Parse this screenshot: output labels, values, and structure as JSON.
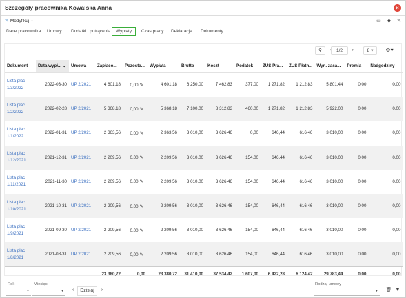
{
  "window": {
    "title": "Szczegóły pracownika Kowalska Anna"
  },
  "toolbar": {
    "modify_label": "Modyfikuj"
  },
  "tabs": [
    {
      "label": "Dane pracownika"
    },
    {
      "label": "Umowy"
    },
    {
      "label": "Dodatki i potrącenia"
    },
    {
      "label": "Wypłaty"
    },
    {
      "label": "Czas pracy"
    },
    {
      "label": "Deklaracje"
    },
    {
      "label": "Dokumenty"
    }
  ],
  "pager": {
    "page": "1/2",
    "page_size": "8"
  },
  "table": {
    "headers": [
      "Dokument",
      "Data wypł...",
      "Umowa",
      "Zapłaco...",
      "Pozosta...",
      "Wypłata",
      "Brutto",
      "Koszt",
      "Podatek",
      "ZUS Pra...",
      "ZUS Płatn...",
      "Wyn. zasa...",
      "Premia",
      "Nadgodziny"
    ],
    "rows": [
      {
        "doc": "Lista płac 1/3/2022",
        "date": "2022-03-30",
        "umowa": "UP 2/2021",
        "zaplacono": "4 601,18",
        "pozostalo": "0,00",
        "wyplata": "4 601,18",
        "brutto": "6 250,00",
        "koszt": "7 462,83",
        "podatek": "377,00",
        "zus_pra": "1 271,82",
        "zus_plat": "1 212,83",
        "wyn_zasad": "5 801,44",
        "premia": "0,00",
        "nadgodziny": "0,00"
      },
      {
        "doc": "Lista płac 1/2/2022",
        "date": "2022-02-28",
        "umowa": "UP 2/2021",
        "zaplacono": "5 368,18",
        "pozostalo": "0,00",
        "wyplata": "5 368,18",
        "brutto": "7 100,00",
        "koszt": "8 312,83",
        "podatek": "460,00",
        "zus_pra": "1 271,82",
        "zus_plat": "1 212,83",
        "wyn_zasad": "5 922,00",
        "premia": "0,00",
        "nadgodziny": "0,00"
      },
      {
        "doc": "Lista płac 1/1/2022",
        "date": "2022-01-31",
        "umowa": "UP 2/2021",
        "zaplacono": "2 363,56",
        "pozostalo": "0,00",
        "wyplata": "2 363,56",
        "brutto": "3 010,00",
        "koszt": "3 626,46",
        "podatek": "0,00",
        "zus_pra": "646,44",
        "zus_plat": "616,46",
        "wyn_zasad": "3 010,00",
        "premia": "0,00",
        "nadgodziny": "0,00"
      },
      {
        "doc": "Lista płac 1/12/2021",
        "date": "2021-12-31",
        "umowa": "UP 2/2021",
        "zaplacono": "2 209,56",
        "pozostalo": "0,00",
        "wyplata": "2 209,56",
        "brutto": "3 010,00",
        "koszt": "3 626,46",
        "podatek": "154,00",
        "zus_pra": "646,44",
        "zus_plat": "616,46",
        "wyn_zasad": "3 010,00",
        "premia": "0,00",
        "nadgodziny": "0,00"
      },
      {
        "doc": "Lista płac 1/11/2021",
        "date": "2021-11-30",
        "umowa": "UP 2/2021",
        "zaplacono": "2 209,56",
        "pozostalo": "0,00",
        "wyplata": "2 209,56",
        "brutto": "3 010,00",
        "koszt": "3 626,46",
        "podatek": "154,00",
        "zus_pra": "646,44",
        "zus_plat": "616,46",
        "wyn_zasad": "3 010,00",
        "premia": "0,00",
        "nadgodziny": "0,00"
      },
      {
        "doc": "Lista płac 1/10/2021",
        "date": "2021-10-31",
        "umowa": "UP 2/2021",
        "zaplacono": "2 209,56",
        "pozostalo": "0,00",
        "wyplata": "2 209,56",
        "brutto": "3 010,00",
        "koszt": "3 626,46",
        "podatek": "154,00",
        "zus_pra": "646,44",
        "zus_plat": "616,46",
        "wyn_zasad": "3 010,00",
        "premia": "0,00",
        "nadgodziny": "0,00"
      },
      {
        "doc": "Lista płac 1/9/2021",
        "date": "2021-09-30",
        "umowa": "UP 2/2021",
        "zaplacono": "2 209,56",
        "pozostalo": "0,00",
        "wyplata": "2 209,56",
        "brutto": "3 010,00",
        "koszt": "3 626,46",
        "podatek": "154,00",
        "zus_pra": "646,44",
        "zus_plat": "616,46",
        "wyn_zasad": "3 010,00",
        "premia": "0,00",
        "nadgodziny": "0,00"
      },
      {
        "doc": "Lista płac 1/8/2021",
        "date": "2021-08-31",
        "umowa": "UP 2/2021",
        "zaplacono": "2 209,56",
        "pozostalo": "0,00",
        "wyplata": "2 209,56",
        "brutto": "3 010,00",
        "koszt": "3 626,46",
        "podatek": "154,00",
        "zus_pra": "646,44",
        "zus_plat": "616,46",
        "wyn_zasad": "3 010,00",
        "premia": "0,00",
        "nadgodziny": "0,00"
      }
    ],
    "totals": {
      "zaplacono": "23 380,72",
      "pozostalo": "0,00",
      "wyplata": "23 380,72",
      "brutto": "31 410,00",
      "koszt": "37 534,42",
      "podatek": "1 607,00",
      "zus_pra": "6 422,28",
      "zus_plat": "6 124,42",
      "wyn_zasad": "29 783,44",
      "premia": "0,00",
      "nadgodziny": "0,00"
    }
  },
  "filters": {
    "rok_label": "Rok",
    "miesiac_label": "Miesiąc",
    "today_label": "Dzisiaj",
    "rodzaj_label": "Rodzaj umowy"
  }
}
